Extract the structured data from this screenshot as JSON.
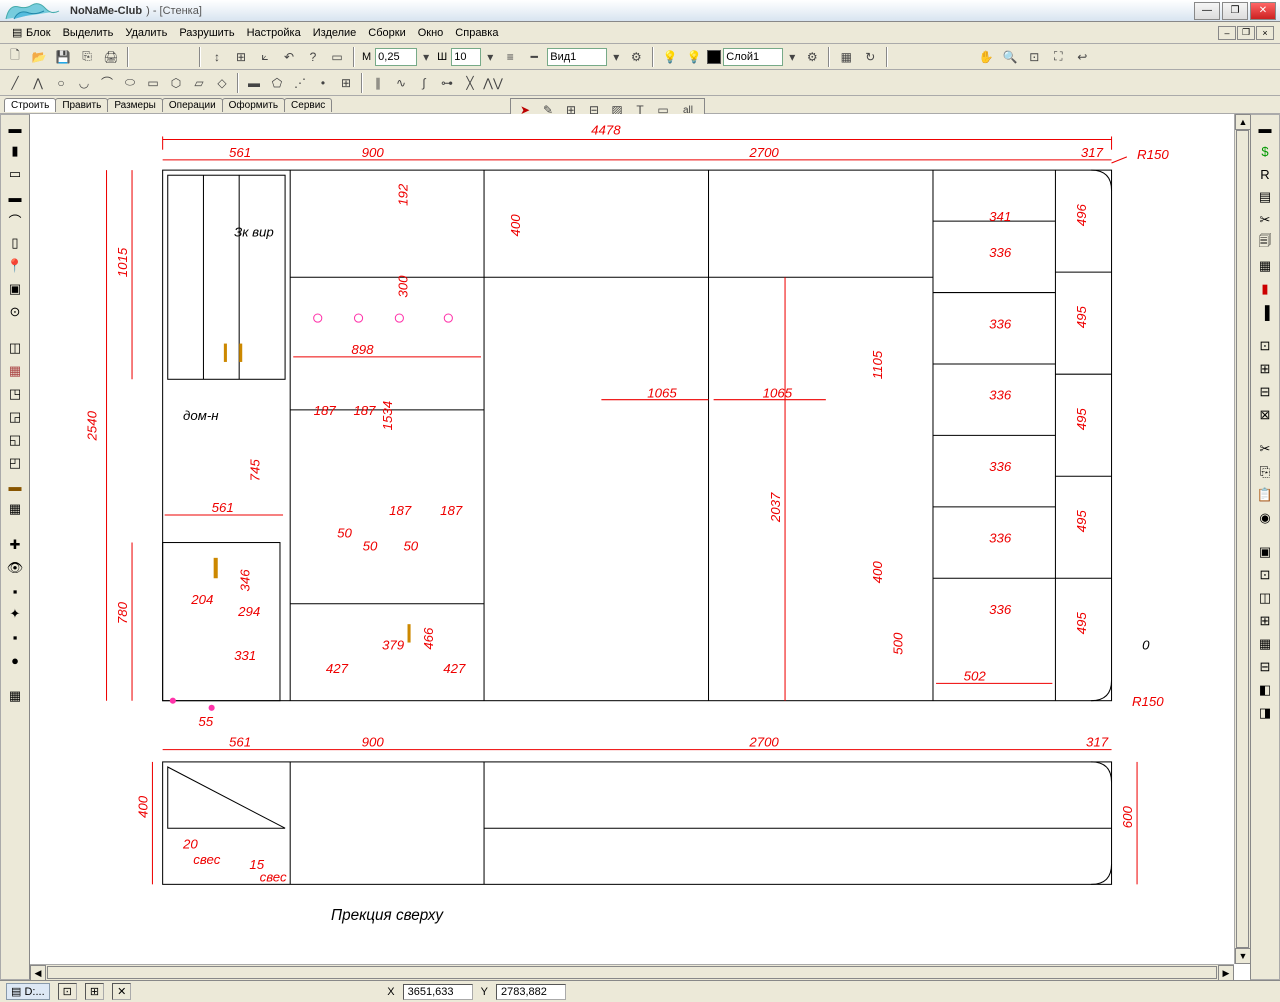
{
  "title": {
    "brand": "NoNaMe-Club",
    "doc_suffix": ") - [Стенка]"
  },
  "menu": [
    "Блок",
    "Выделить",
    "Удалить",
    "Разрушить",
    "Настройка",
    "Изделие",
    "Сборки",
    "Окно",
    "Справка"
  ],
  "toolbar": {
    "m_label": "М",
    "m_value": "0,25",
    "w_label": "Ш",
    "w_value": "10",
    "view_label": "Вид1",
    "layer_label": "Слой1"
  },
  "tabs": [
    "Строить",
    "Править",
    "Размеры",
    "Операции",
    "Оформить",
    "Сервис"
  ],
  "status": {
    "file_prefix": "D:...",
    "x_label": "X",
    "x_value": "3651,633",
    "y_label": "Y",
    "y_value": "2783,882"
  },
  "drawing": {
    "overall_width": "4478",
    "seg_widths_top": [
      "561",
      "900",
      "2700",
      "317"
    ],
    "seg_widths_bottom": [
      "561",
      "900",
      "2700",
      "317"
    ],
    "radius": "R150",
    "heights_left": {
      "total": "2540",
      "upper": "1015",
      "mid": "745",
      "lower": "780",
      "svec_55": "55"
    },
    "heights_right": {
      "h496": "496",
      "h495_a": "495",
      "h495_b": "495",
      "h495_c": "495",
      "h495_d": "495",
      "h600": "600",
      "h341": "341"
    },
    "shelf_336": "336",
    "shelf_502": "502",
    "door_2037": "2037",
    "door_1065": "1065",
    "door_1105": "1105",
    "door_400_v": "400",
    "door_500": "500",
    "inner_898": "898",
    "inner_187": "187",
    "inner_50": "50",
    "inner_1534": "1534",
    "inner_300": "300",
    "inner_192": "192",
    "inner_400": "400",
    "lower_204": "204",
    "lower_294": "294",
    "lower_331": "331",
    "lower_346": "346",
    "lower_427": "427",
    "lower_379": "379",
    "lower_466": "466",
    "label_dom": "дом-н",
    "label_3kwir": "Зк вир",
    "label_0": "0",
    "label_projection": "Прекция сверху",
    "top_400": "400",
    "top_20": "20",
    "top_15": "15",
    "top_svec": "свес"
  },
  "float_all": "all"
}
